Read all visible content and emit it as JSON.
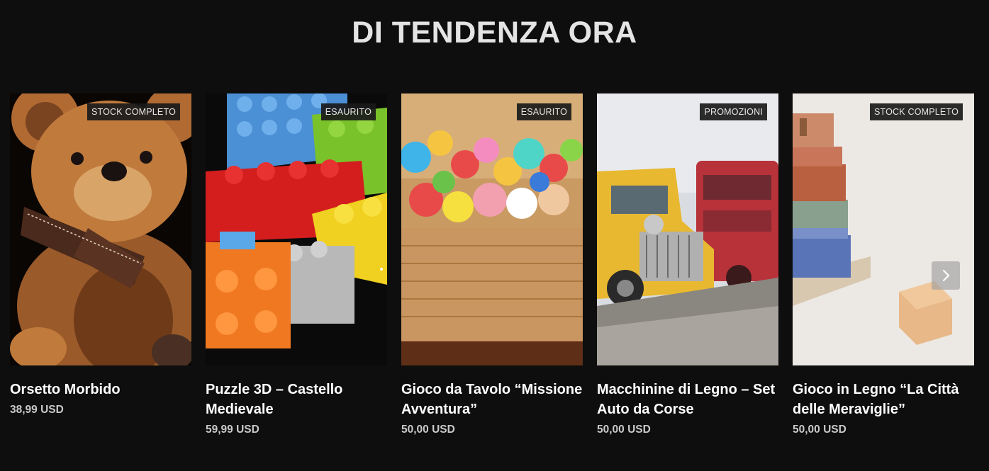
{
  "section": {
    "title": "DI TENDENZA ORA"
  },
  "products": [
    {
      "title": "Orsetto Morbido",
      "price": "38,99 USD",
      "badge": "STOCK COMPLETO",
      "icon": "teddy-bear"
    },
    {
      "title": "Puzzle 3D – Castello Medievale",
      "price": "59,99 USD",
      "badge": "ESAURITO",
      "icon": "building-blocks"
    },
    {
      "title": "Gioco da Tavolo “Missione Avventura”",
      "price": "50,00 USD",
      "badge": "ESAURITO",
      "icon": "toy-box"
    },
    {
      "title": "Macchinine di Legno – Set Auto da Corse",
      "price": "50,00 USD",
      "badge": "PROMOZIONI",
      "icon": "toy-car"
    },
    {
      "title": "Gioco in Legno “La Città delle Meraviglie”",
      "price": "50,00 USD",
      "badge": "STOCK COMPLETO",
      "icon": "wooden-stacker"
    }
  ],
  "carousel": {
    "next_icon": "chevron-right-icon"
  },
  "colors": {
    "background": "#0e0e0e",
    "title": "#e4e4e4",
    "badge_bg": "#1a1a1a",
    "price": "#c9c9c9"
  }
}
